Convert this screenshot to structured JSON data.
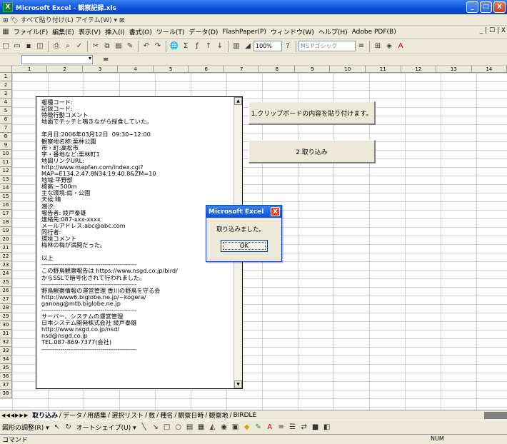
{
  "window": {
    "title": "Microsoft Excel - 観察記録.xls",
    "app_icon": "X",
    "minimize": "_",
    "restore": "□",
    "close": "X"
  },
  "linkbar": {
    "text": "⊞ 🏷 すべて貼り付け(L)  アイテム(W) ▾ ⊠"
  },
  "menu": {
    "items": [
      "ファイル(F)",
      "編集(E)",
      "表示(V)",
      "挿入(I)",
      "書式(O)",
      "ツール(T)",
      "データ(D)",
      "FlashPaper(P)",
      "ウィンドウ(W)",
      "ヘルプ(H)",
      "Adobe PDF(B)"
    ],
    "mdi_buttons": "_ | ☐ | X"
  },
  "toolbar": {
    "zoom": "100%",
    "font": "MS Pゴシック",
    "help": "?"
  },
  "formula": {
    "fx": "="
  },
  "columns": [
    "1",
    "2",
    "3",
    "4",
    "5",
    "6",
    "7",
    "8",
    "9",
    "10",
    "11",
    "12",
    "13",
    "14"
  ],
  "rows": [
    "1",
    "2",
    "3",
    "4",
    "5",
    "6",
    "7",
    "8",
    "9",
    "10",
    "11",
    "12",
    "13",
    "14",
    "15",
    "16",
    "17",
    "18",
    "19",
    "20",
    "21",
    "22",
    "23",
    "24",
    "25",
    "26",
    "27",
    "28",
    "29",
    "30",
    "31",
    "32",
    "33",
    "34",
    "35",
    "36",
    "37",
    "38"
  ],
  "textbox": {
    "lines": [
      "報種コード:",
      "記録コード:",
      "特徴行動コメント",
      "地面でチッチと鳴きながら採食していた。",
      "",
      "年月日:2006年03月12日  09:30~12:00",
      "観察地名称:栗林公園",
      "市・町:高松市",
      "字・番地など:栗林町1",
      "地図リンクURL:",
      "http://www.mapfan.com/index.cgi?",
      "MAP=E134.2.47.8N34.19.40.8&ZM=10",
      "地域:平野部",
      "標高:~500m",
      "主な環境:庭・公園",
      "天候:晴",
      "潮汐:",
      "報告者: 綾戸泰雄",
      "連絡先:087-xxx-xxxx",
      "メールアドレス:abc@abc.com",
      "同行者:",
      "環境コメント",
      "梅林の梅が満開だった。",
      "",
      "以上",
      "---------------------------------------------",
      "この野鳥観察報告は https://www.nsgd.co.jp/bird/",
      "からSSLで暗号化されて行われました。",
      "---------------------------------------------",
      "野鳥観察情報の運営管理 香川の野鳥を守る会",
      "http://www6.biglobe.ne.jp/~kogera/",
      "ganoag@mtb.biglobe.ne.jp",
      "---------------------------------------------",
      "サーバー、システムの運営管理",
      "日本システム開発株式会社 綾戸泰雄",
      "http://www.nsgd.co.jp/nsd/",
      "nsd@nsgd.co.jp",
      "TEL.087-869-7377(会社)",
      "---------------------------------------------"
    ]
  },
  "buttons": {
    "paste": "1.クリップボードの内容を貼り付けます。",
    "import": "2.取り込み"
  },
  "dialog": {
    "title": "Microsoft Excel",
    "message": "取り込みました。",
    "ok": "OK",
    "close": "X"
  },
  "sheet_tabs": {
    "nav": "◀◀◀▶▶▶",
    "tabs": [
      "取り込み",
      "データ",
      "用語集",
      "選択リスト",
      "数",
      "種名",
      "観察日時",
      "観察地",
      "BIRDLE"
    ]
  },
  "drawbar": {
    "draw": "図形の調整(R) ▾",
    "autoshape": "オートシェイプ(U) ▾"
  },
  "status": {
    "mode": "コマンド",
    "num": "NUM"
  }
}
